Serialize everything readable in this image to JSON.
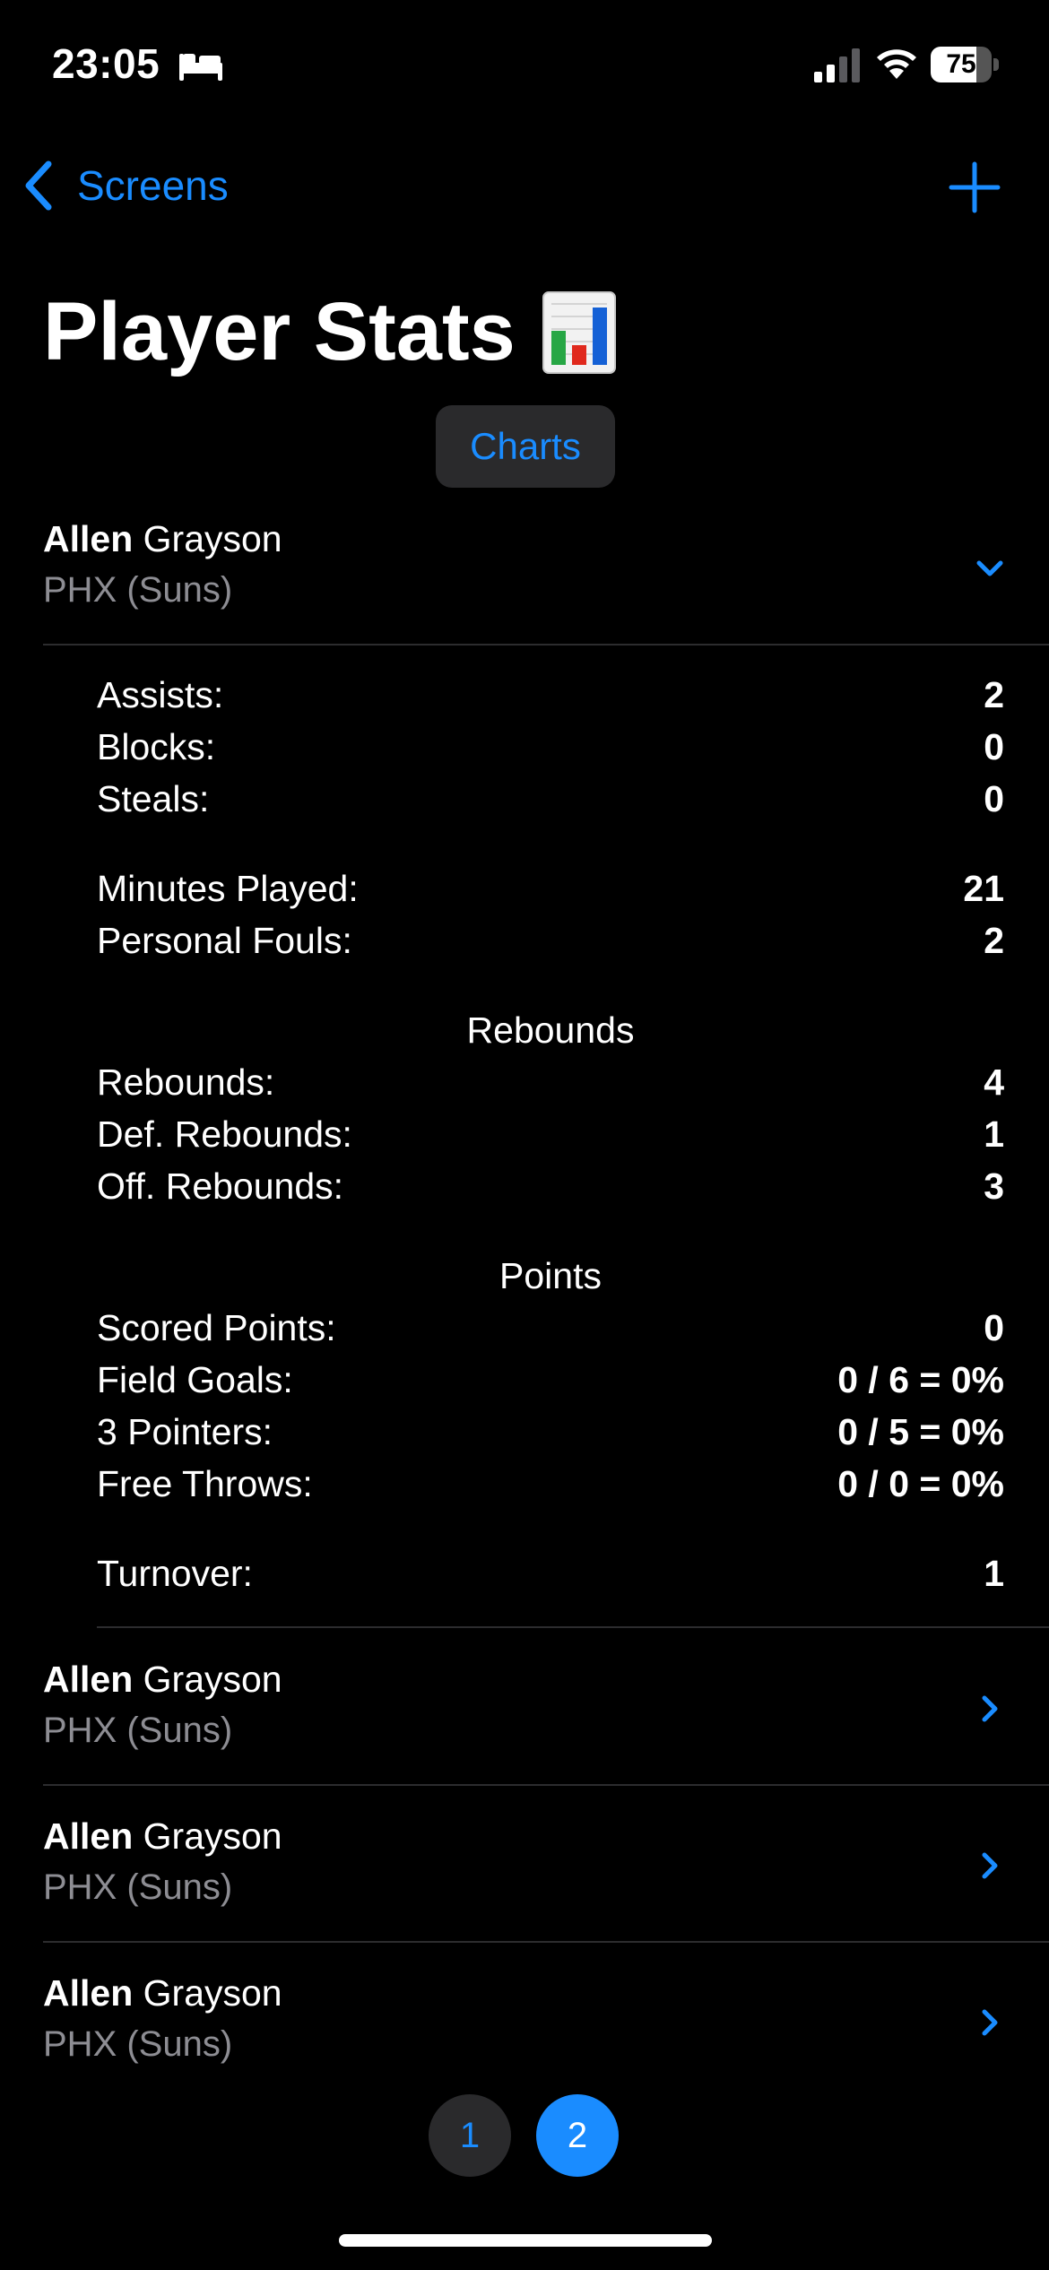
{
  "status_bar": {
    "time": "23:05",
    "battery": "75"
  },
  "nav": {
    "back_label": "Screens"
  },
  "page": {
    "title": "Player Stats",
    "charts_button": "Charts"
  },
  "players": [
    {
      "first": "Allen",
      "last": "Grayson",
      "team": "PHX (Suns)",
      "expanded": true
    },
    {
      "first": "Allen",
      "last": "Grayson",
      "team": "PHX (Suns)",
      "expanded": false
    },
    {
      "first": "Allen",
      "last": "Grayson",
      "team": "PHX (Suns)",
      "expanded": false
    },
    {
      "first": "Allen",
      "last": "Grayson",
      "team": "PHX (Suns)",
      "expanded": false
    }
  ],
  "stats": {
    "general": [
      {
        "label": "Assists:",
        "value": "2"
      },
      {
        "label": "Blocks:",
        "value": "0"
      },
      {
        "label": "Steals:",
        "value": "0"
      }
    ],
    "time": [
      {
        "label": "Minutes Played:",
        "value": "21"
      },
      {
        "label": "Personal Fouls:",
        "value": "2"
      }
    ],
    "rebounds_title": "Rebounds",
    "rebounds": [
      {
        "label": "Rebounds:",
        "value": "4"
      },
      {
        "label": "Def. Rebounds:",
        "value": "1"
      },
      {
        "label": "Off. Rebounds:",
        "value": "3"
      }
    ],
    "points_title": "Points",
    "points": [
      {
        "label": "Scored Points:",
        "value": "0"
      },
      {
        "label": "Field Goals:",
        "value": "0 / 6 = 0%"
      },
      {
        "label": "3 Pointers:",
        "value": "0 / 5 = 0%"
      },
      {
        "label": "Free Throws:",
        "value": "0 / 0 = 0%"
      }
    ],
    "other": [
      {
        "label": "Turnover:",
        "value": "1"
      }
    ]
  },
  "pagination": {
    "pages": [
      "1",
      "2"
    ],
    "current": "2"
  },
  "colors": {
    "accent": "#1a8cff",
    "background": "#000000",
    "secondary_text": "#8d8d93",
    "button_bg": "#2a2a2c",
    "separator": "#2c2c2e"
  }
}
